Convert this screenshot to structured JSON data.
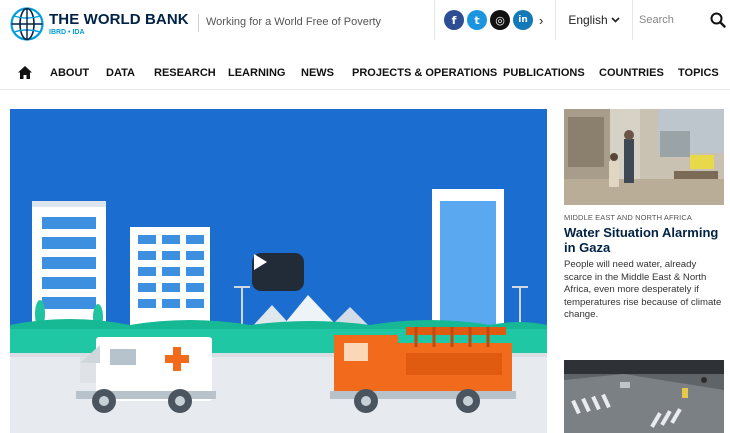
{
  "header": {
    "logo_name": "THE WORLD BANK",
    "logo_sub": "IBRD • IDA",
    "tagline": "Working for a World Free of Poverty",
    "social": [
      {
        "icon": "facebook-icon",
        "glyph": "f"
      },
      {
        "icon": "twitter-icon",
        "glyph": "t"
      },
      {
        "icon": "instagram-icon",
        "glyph": "◎"
      },
      {
        "icon": "linkedin-icon",
        "glyph": "in"
      }
    ],
    "social_more": "›",
    "language": "English",
    "search_placeholder": "Search"
  },
  "nav": {
    "items": [
      "ABOUT",
      "DATA",
      "RESEARCH",
      "LEARNING",
      "NEWS",
      "PROJECTS & OPERATIONS",
      "PUBLICATIONS",
      "COUNTRIES",
      "TOPICS"
    ]
  },
  "side_story": {
    "region": "MIDDLE EAST AND NORTH AFRICA",
    "title": "Water Situation Alarming in Gaza",
    "description": "People will need water, already scarce in the Middle East & North Africa, even more desperately if temperatures rise because of climate change."
  },
  "colors": {
    "brand": "#002244",
    "accent": "#009fda",
    "hero_sky": "#1c6dd0",
    "hero_grass": "#1fc7a4",
    "fire_truck": "#f26b1d"
  }
}
